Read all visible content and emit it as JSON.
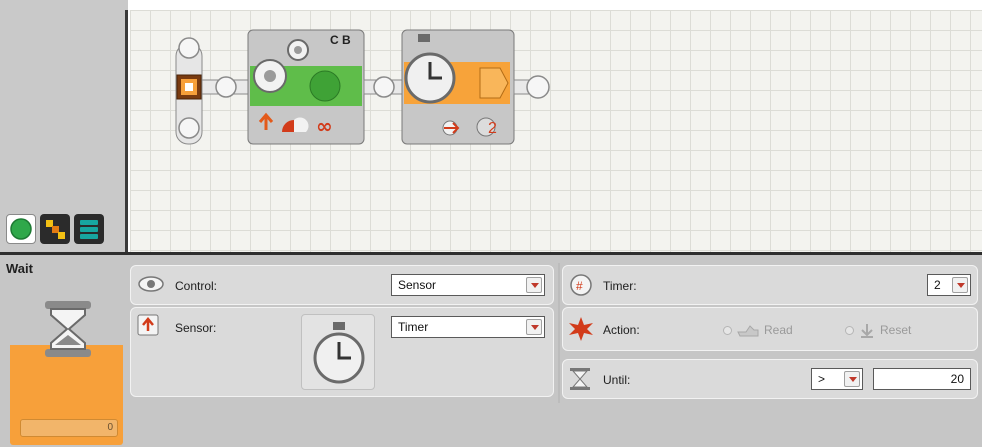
{
  "palette": {
    "tabs": [
      {
        "name": "common",
        "color": "#2fa84a",
        "active": true
      },
      {
        "name": "complete",
        "color": "#f2c014",
        "active": false
      },
      {
        "name": "custom",
        "color": "#17a6a0",
        "active": false
      }
    ]
  },
  "program": {
    "motor_block": {
      "ports": "C B",
      "colors": {
        "body": "#c7c7c7",
        "band": "#5fbd4a",
        "icon": "#3fa236"
      }
    },
    "wait_block": {
      "timer_number": "2",
      "colors": {
        "body": "#c7c7c7",
        "band": "#f7a33a"
      }
    }
  },
  "config_panel": {
    "block_name": "Wait",
    "preview_value": "0",
    "control": {
      "label": "Control:",
      "value": "Sensor"
    },
    "sensor": {
      "label": "Sensor:",
      "value": "Timer"
    },
    "timer": {
      "label": "Timer:",
      "value": "2"
    },
    "action": {
      "label": "Action:",
      "options": [
        "Read",
        "Reset"
      ]
    },
    "until": {
      "label": "Until:",
      "operator": ">",
      "value": "20"
    }
  },
  "colors": {
    "accent_orange": "#f7a03a",
    "motor_green": "#5fbd4a",
    "panel_bg": "#c6c6c6",
    "canvas_bg": "#f3f3ef"
  }
}
